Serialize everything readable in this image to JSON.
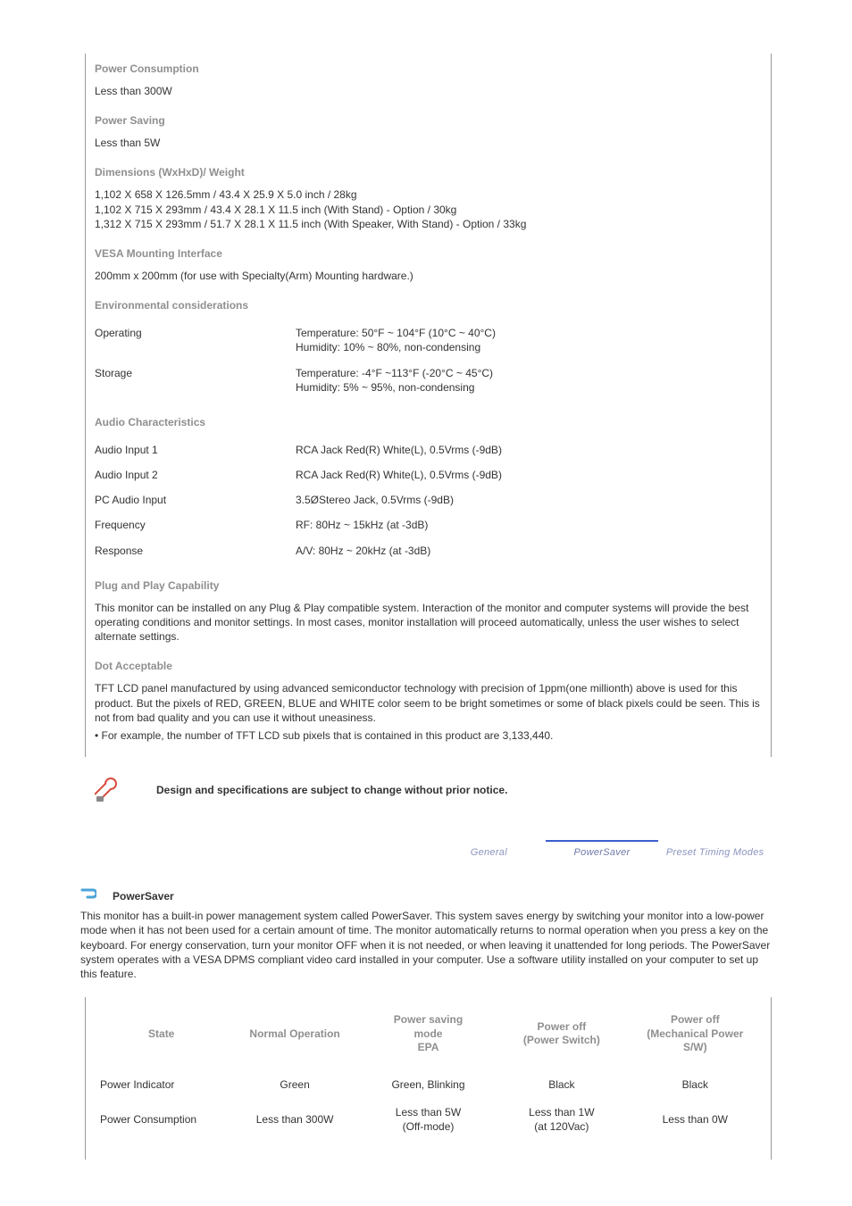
{
  "specs": {
    "power_consumption": {
      "heading": "Power Consumption",
      "value": "Less than 300W"
    },
    "power_saving": {
      "heading": "Power Saving",
      "value": "Less than 5W"
    },
    "dimensions": {
      "heading": "Dimensions (WxHxD)/ Weight",
      "line1": "1,102 X 658 X 126.5mm / 43.4 X 25.9 X 5.0 inch / 28kg",
      "line2": "1,102 X 715 X 293mm / 43.4 X 28.1 X 11.5 inch (With Stand) - Option / 30kg",
      "line3": "1,312 X 715 X 293mm / 51.7 X 28.1 X 11.5 inch (With Speaker, With Stand) - Option / 33kg"
    },
    "vesa": {
      "heading": "VESA Mounting Interface",
      "value": "200mm x 200mm (for use with Specialty(Arm) Mounting hardware.)"
    },
    "env": {
      "heading": "Environmental considerations",
      "operating_label": "Operating",
      "operating_val1": "Temperature: 50°F ~ 104°F (10°C ~ 40°C)",
      "operating_val2": "Humidity: 10% ~ 80%, non-condensing",
      "storage_label": "Storage",
      "storage_val1": "Temperature: -4°F ~113°F (-20°C ~ 45°C)",
      "storage_val2": "Humidity: 5% ~ 95%, non-condensing"
    },
    "audio": {
      "heading": "Audio Characteristics",
      "rows": [
        {
          "label": "Audio Input 1",
          "value": "RCA Jack Red(R) White(L), 0.5Vrms (-9dB)"
        },
        {
          "label": "Audio Input 2",
          "value": "RCA Jack Red(R) White(L), 0.5Vrms (-9dB)"
        },
        {
          "label": "PC Audio Input",
          "value": "3.5ØStereo Jack, 0.5Vrms (-9dB)"
        },
        {
          "label": "Frequency",
          "value": "RF: 80Hz ~ 15kHz (at -3dB)"
        },
        {
          "label": "Response",
          "value": "A/V: 80Hz ~ 20kHz (at -3dB)"
        }
      ]
    },
    "pnp": {
      "heading": "Plug and Play Capability",
      "body": "This monitor can be installed on any Plug & Play compatible system. Interaction of the monitor and computer systems will provide the best operating conditions and monitor settings. In most cases, monitor installation will proceed automatically, unless the user wishes to select alternate settings."
    },
    "dot": {
      "heading": "Dot Acceptable",
      "body": "TFT LCD panel manufactured by using advanced semiconductor technology with precision of 1ppm(one millionth) above is used for this product. But the pixels of RED, GREEN, BLUE and WHITE color seem to be bright sometimes or some of black pixels could be seen. This is not from bad quality and you can use it without uneasiness.",
      "bullet": "For example, the number of TFT LCD sub pixels that is contained in this product are 3,133,440."
    }
  },
  "notice": "Design and specifications are subject to change without prior notice.",
  "tabs": {
    "general": "General",
    "powersaver": "PowerSaver",
    "preset": "Preset Timing Modes"
  },
  "powersaver": {
    "title": "PowerSaver",
    "body": "This monitor has a built-in power management system called PowerSaver. This system saves energy by switching your monitor into a low-power mode when it has not been used for a certain amount of time. The monitor automatically returns to normal operation when you press a key on the keyboard. For energy conservation, turn your monitor OFF when it is not needed, or when leaving it unattended for long periods. The PowerSaver system operates with a VESA DPMS compliant video card installed in your computer. Use a software utility installed on your computer to set up this feature.",
    "table": {
      "headers": {
        "state": "State",
        "normal": "Normal Operation",
        "saving_l1": "Power saving",
        "saving_l2": "mode",
        "saving_l3": "EPA",
        "off1_l1": "Power off",
        "off1_l2": "(Power Switch)",
        "off2_l1": "Power off",
        "off2_l2": "(Mechanical Power",
        "off2_l3": "S/W)"
      },
      "rows": [
        {
          "label": "Power Indicator",
          "normal": "Green",
          "saving": "Green, Blinking",
          "off1": "Black",
          "off2": "Black"
        },
        {
          "label": "Power Consumption",
          "normal": "Less than 300W",
          "saving_l1": "Less than 5W",
          "saving_l2": "(Off-mode)",
          "off1_l1": "Less than 1W",
          "off1_l2": "(at 120Vac)",
          "off2": "Less than 0W"
        }
      ]
    }
  }
}
